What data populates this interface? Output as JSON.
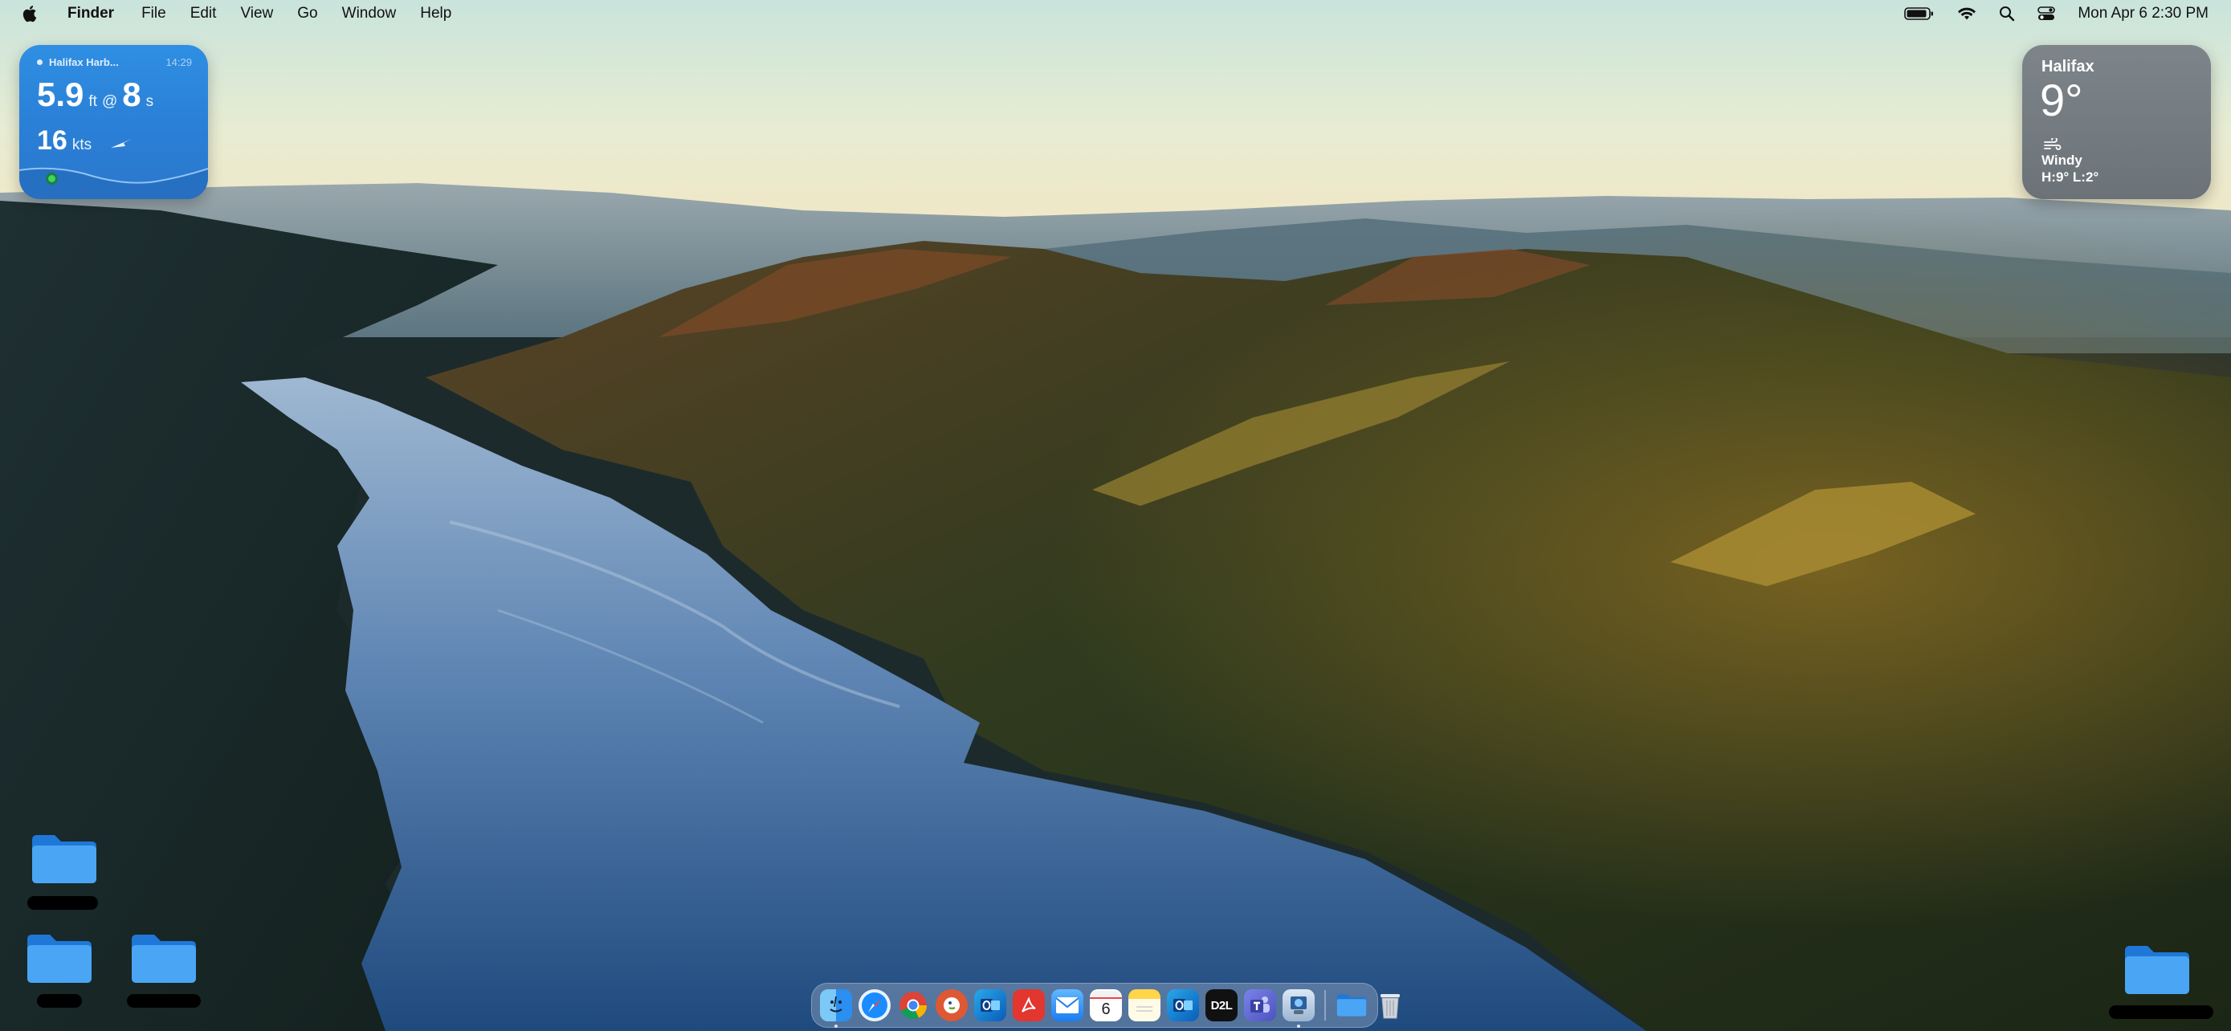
{
  "menubar": {
    "app_name": "Finder",
    "menus": [
      "File",
      "Edit",
      "View",
      "Go",
      "Window",
      "Help"
    ],
    "clock": "Mon Apr 6  2:30 PM",
    "status_icons": [
      "battery-icon",
      "wifi-icon",
      "spotlight-search-icon",
      "control-center-icon"
    ]
  },
  "tide_widget": {
    "location": "Halifax Harb...",
    "time": "14:29",
    "swell_height": "5.9",
    "swell_height_unit": "ft",
    "at_symbol": "@",
    "swell_period": "8",
    "swell_period_unit": "s",
    "wind_speed": "16",
    "wind_unit": "kts",
    "accent_color": "#2f8fe3"
  },
  "weather_widget": {
    "city": "Halifax",
    "temperature": "9°",
    "condition": "Windy",
    "high_low": "H:9° L:2°",
    "icon": "wind-icon"
  },
  "desktop_icons": [
    {
      "name": "folder",
      "icon": "folder-icon"
    },
    {
      "name": "folder",
      "icon": "folder-icon"
    },
    {
      "name": "folder",
      "icon": "folder-icon"
    },
    {
      "name": "folder",
      "icon": "folder-icon"
    }
  ],
  "dock": {
    "apps": [
      {
        "name": "Finder",
        "icon": "finder-icon",
        "running": true
      },
      {
        "name": "Safari",
        "icon": "safari-icon",
        "running": false
      },
      {
        "name": "Chrome",
        "icon": "chrome-icon",
        "running": false
      },
      {
        "name": "DuckDuckGo",
        "icon": "duckduckgo-icon",
        "running": false
      },
      {
        "name": "Outlook",
        "icon": "outlook-icon",
        "running": false
      },
      {
        "name": "Acrobat",
        "icon": "acrobat-icon",
        "running": false
      },
      {
        "name": "Mail",
        "icon": "mail-icon",
        "running": false
      },
      {
        "name": "Calendar",
        "icon": "calendar-icon",
        "running": false,
        "badge_text": "6"
      },
      {
        "name": "Notes",
        "icon": "notes-icon",
        "running": false
      },
      {
        "name": "Outlook",
        "icon": "outlook-icon",
        "running": false
      },
      {
        "name": "D2L",
        "icon": "d2l-icon",
        "running": false,
        "badge_text": "D2L"
      },
      {
        "name": "Teams",
        "icon": "teams-icon",
        "running": false
      },
      {
        "name": "Preview",
        "icon": "preview-icon",
        "running": true
      }
    ],
    "stack": [
      {
        "name": "Downloads",
        "icon": "folder-icon"
      },
      {
        "name": "Trash",
        "icon": "trash-icon"
      }
    ]
  }
}
